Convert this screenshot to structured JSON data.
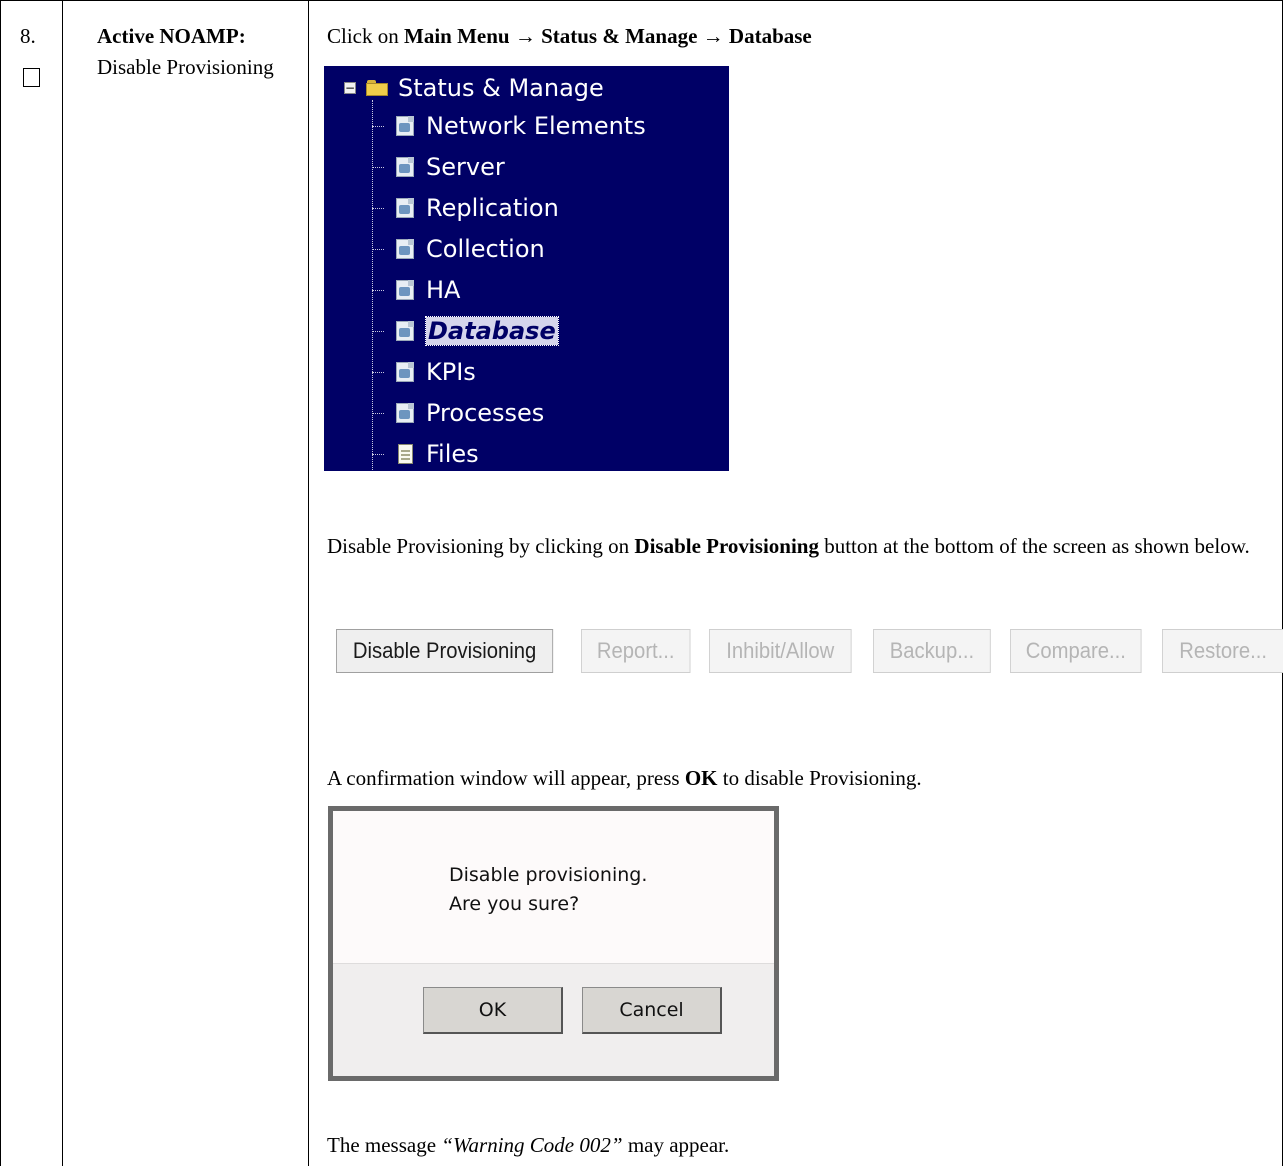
{
  "step": {
    "number": "8.",
    "title": "Active NOAMP:",
    "description": "Disable Provisioning"
  },
  "instruction1": {
    "prefix": "Click on ",
    "path": "Main Menu → Status & Manage → Database"
  },
  "menu": {
    "root_label": "Status & Manage",
    "items": [
      {
        "label": "Network Elements",
        "icon": "page-icon"
      },
      {
        "label": "Server",
        "icon": "page-icon"
      },
      {
        "label": "Replication",
        "icon": "page-icon"
      },
      {
        "label": "Collection",
        "icon": "page-icon"
      },
      {
        "label": "HA",
        "icon": "page-icon"
      },
      {
        "label": "Database",
        "icon": "page-icon",
        "selected": true
      },
      {
        "label": "KPIs",
        "icon": "page-icon"
      },
      {
        "label": "Processes",
        "icon": "page-icon"
      },
      {
        "label": "Files",
        "icon": "file-icon"
      }
    ]
  },
  "instruction2": {
    "prefix": "Disable Provisioning by clicking on ",
    "bold": "Disable Provisioning",
    "suffix": " button at the bottom of the screen as shown below."
  },
  "buttons": [
    {
      "label": "Disable Provisioning",
      "enabled": true
    },
    {
      "label": "Report...",
      "enabled": false
    },
    {
      "label": "Inhibit/Allow",
      "enabled": false
    },
    {
      "label": "Backup...",
      "enabled": false
    },
    {
      "label": "Compare...",
      "enabled": false
    },
    {
      "label": "Restore...",
      "enabled": false
    }
  ],
  "instruction3": {
    "prefix": "A confirmation window will appear, press ",
    "bold": "OK",
    "suffix": " to disable Provisioning."
  },
  "dialog": {
    "line1": "Disable provisioning.",
    "line2": "Are you sure?",
    "ok_label": "OK",
    "cancel_label": "Cancel"
  },
  "instruction4": {
    "prefix": "The message ",
    "italic": "“Warning Code 002”",
    "suffix": " may appear."
  }
}
